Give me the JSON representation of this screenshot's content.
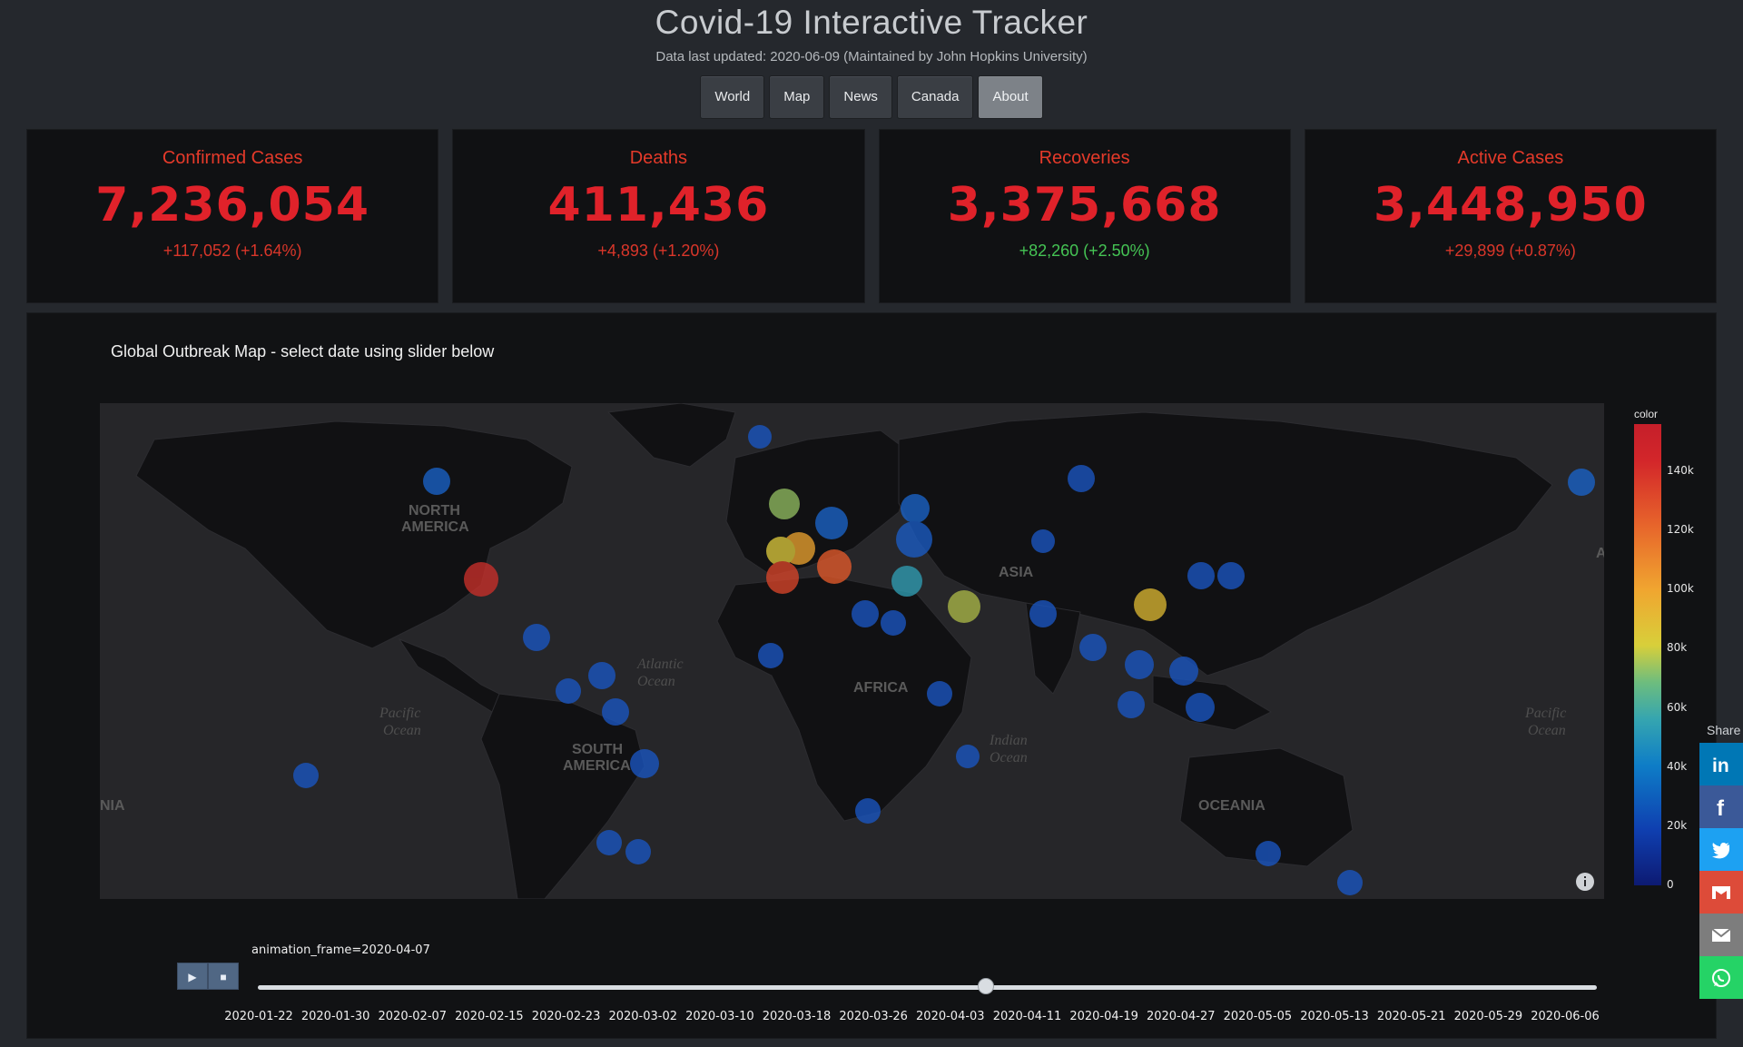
{
  "header": {
    "title": "Covid-19 Interactive Tracker",
    "subtitle": "Data last updated: 2020-06-09 (Maintained by John Hopkins University)"
  },
  "nav": {
    "items": [
      "World",
      "Map",
      "News",
      "Canada",
      "About"
    ],
    "active": "About"
  },
  "cards": [
    {
      "title": "Confirmed Cases",
      "value": "7,236,054",
      "delta": "+117,052 (+1.64%)"
    },
    {
      "title": "Deaths",
      "value": "411,436",
      "delta": "+4,893 (+1.20%)"
    },
    {
      "title": "Recoveries",
      "value": "3,375,668",
      "delta": "+82,260 (+2.50%)"
    },
    {
      "title": "Active Cases",
      "value": "3,448,950",
      "delta": "+29,899 (+0.87%)"
    }
  ],
  "map_panel": {
    "title": "Global Outbreak Map - select date using slider below",
    "labels": [
      "NORTH",
      "AMERICA",
      "SOUTH",
      "AMERICA",
      "AFRICA",
      "ASIA",
      "OCEANIA",
      "Atlantic",
      "Ocean",
      "Pacific",
      "Ocean",
      "Pacific",
      "Ocean",
      "Indian",
      "Ocean",
      "NIA",
      "A"
    ],
    "colorbar": {
      "title": "color",
      "ticks": [
        "140k",
        "120k",
        "100k",
        "80k",
        "60k",
        "40k",
        "20k",
        "0"
      ],
      "tick_values": [
        140000,
        120000,
        100000,
        80000,
        60000,
        40000,
        20000,
        0
      ],
      "max": 156000
    }
  },
  "animation": {
    "play_icon": "▶",
    "stop_icon": "■",
    "frame_label": "animation_frame=2020-04-07",
    "current_fraction": 0.5434,
    "dates": [
      "2020-01-22",
      "2020-01-30",
      "2020-02-07",
      "2020-02-15",
      "2020-02-23",
      "2020-03-02",
      "2020-03-10",
      "2020-03-18",
      "2020-03-26",
      "2020-04-03",
      "2020-04-11",
      "2020-04-19",
      "2020-04-27",
      "2020-05-05",
      "2020-05-13",
      "2020-05-21",
      "2020-05-29",
      "2020-06-06"
    ]
  },
  "share": {
    "label": "Share",
    "buttons": [
      {
        "name": "linkedin",
        "color": "#0077b5",
        "glyph": "in"
      },
      {
        "name": "facebook",
        "color": "#3b5998",
        "glyph": "f"
      },
      {
        "name": "twitter",
        "color": "#1da1f2",
        "glyph": "t"
      },
      {
        "name": "gmail",
        "color": "#dd4b39",
        "glyph": "M"
      },
      {
        "name": "email",
        "color": "#7d7d7d",
        "glyph": "✉"
      },
      {
        "name": "whatsapp",
        "color": "#25d366",
        "glyph": "w"
      }
    ]
  }
}
